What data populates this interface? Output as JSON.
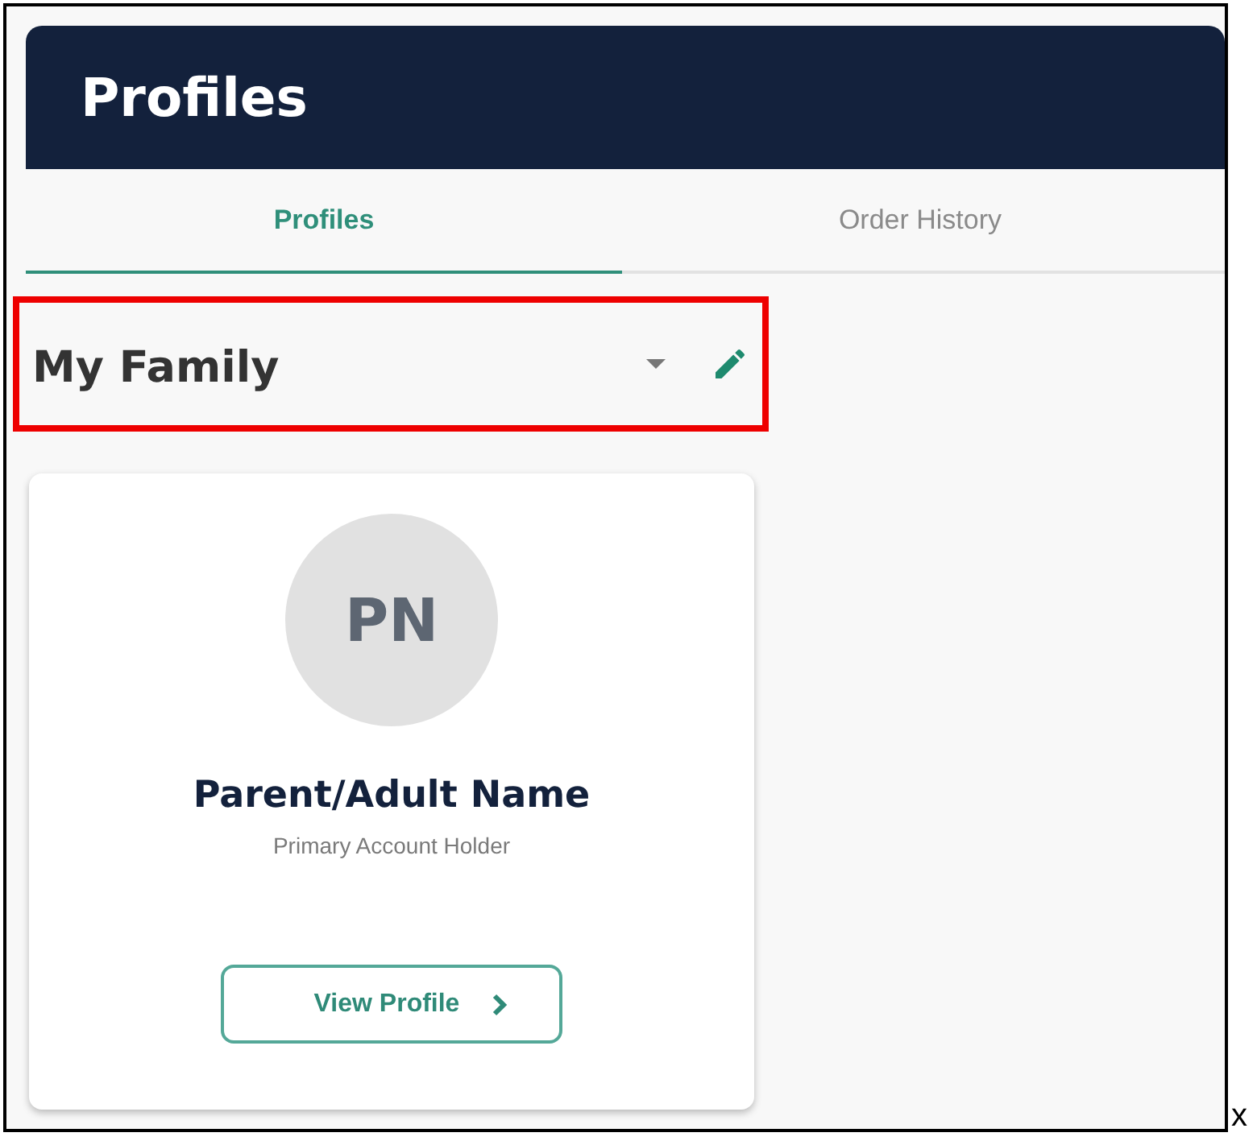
{
  "header": {
    "title": "Profiles"
  },
  "tabs": [
    {
      "label": "Profiles",
      "selected": true
    },
    {
      "label": "Order History",
      "selected": false
    }
  ],
  "family_selector": {
    "value": "My Family",
    "highlighted": true
  },
  "profile_cards": [
    {
      "initials": "PN",
      "name": "Parent/Adult Name",
      "role": "Primary Account Holder",
      "button": "View Profile"
    }
  ],
  "corner_mark": "x"
}
